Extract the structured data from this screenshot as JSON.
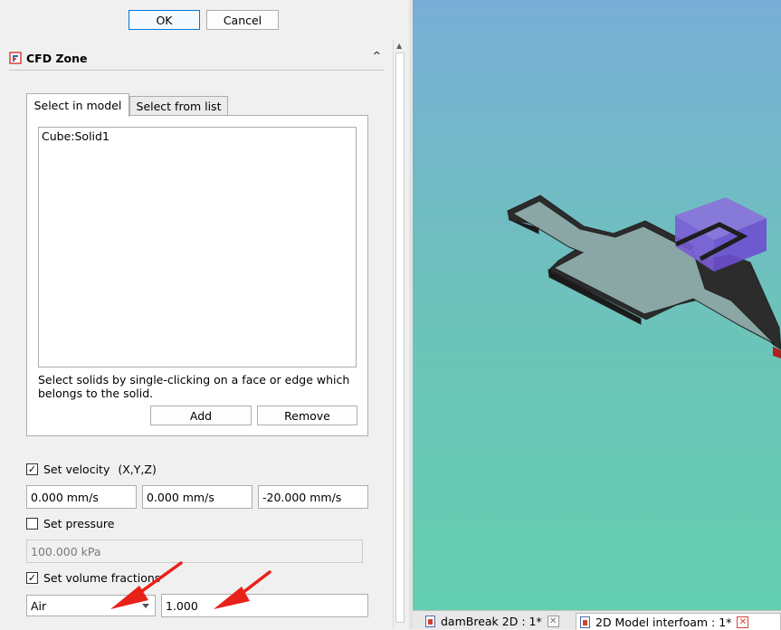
{
  "dialog": {
    "ok_label": "OK",
    "cancel_label": "Cancel"
  },
  "section": {
    "title": "CFD Zone",
    "collapse_glyph": "^"
  },
  "tabs": [
    {
      "label": "Select in model",
      "active": true
    },
    {
      "label": "Select from list",
      "active": false
    }
  ],
  "selection": {
    "items": [
      "Cube:Solid1"
    ],
    "help_text": "Select solids by single-clicking on a face or edge which belongs to the solid.",
    "add_label": "Add",
    "remove_label": "Remove"
  },
  "velocity": {
    "checked": true,
    "label": "Set velocity",
    "suffix": "(X,Y,Z)",
    "x": "0.000 mm/s",
    "y": "0.000 mm/s",
    "z": "-20.000 mm/s"
  },
  "pressure": {
    "checked": false,
    "label": "Set pressure",
    "value": "100.000 kPa"
  },
  "volume_fractions": {
    "checked": true,
    "label": "Set volume fractions",
    "fluid": "Air",
    "value": "1.000"
  },
  "document_tabs": [
    {
      "label": "damBreak 2D : 1*",
      "active": false
    },
    {
      "label": "2D Model interfoam : 1*",
      "active": true
    }
  ],
  "colors": {
    "accent": "#0078d7",
    "annotation_arrow": "#e8211a",
    "zone_box": "#7b5cd6",
    "viewport_top": "#78aed6",
    "viewport_bottom": "#64cfb0"
  }
}
